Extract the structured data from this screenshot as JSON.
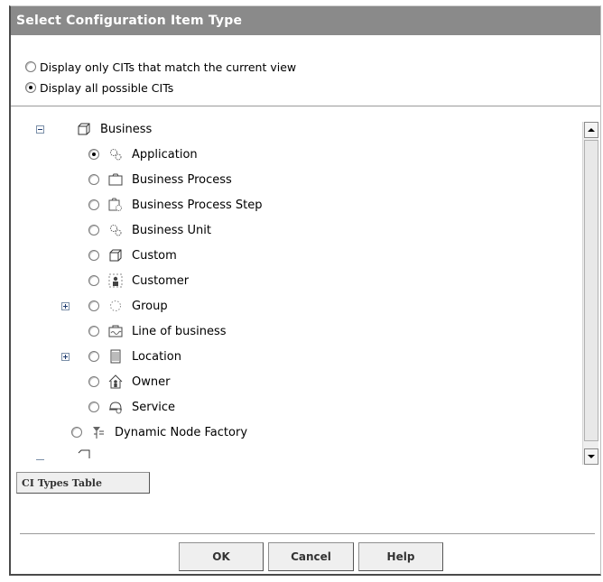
{
  "dialog": {
    "title": "Select Configuration Item Type",
    "options": [
      {
        "label": "Display only CITs that match the current view",
        "checked": false
      },
      {
        "label": "Display all possible CITs",
        "checked": true
      }
    ]
  },
  "tree": {
    "root": {
      "label": "Business",
      "icon": "cube-icon",
      "expanded": true
    },
    "children": [
      {
        "label": "Application",
        "icon": "gears-icon",
        "checked": true,
        "expandable": false
      },
      {
        "label": "Business Process",
        "icon": "folder-icon",
        "checked": false,
        "expandable": false
      },
      {
        "label": "Business Process Step",
        "icon": "process-step-icon",
        "checked": false,
        "expandable": false
      },
      {
        "label": "Business Unit",
        "icon": "gears-icon",
        "checked": false,
        "expandable": false
      },
      {
        "label": "Custom",
        "icon": "cube-icon",
        "checked": false,
        "expandable": false
      },
      {
        "label": "Customer",
        "icon": "customer-icon",
        "checked": false,
        "expandable": false
      },
      {
        "label": "Group",
        "icon": "group-icon",
        "checked": false,
        "expandable": true
      },
      {
        "label": "Line of business",
        "icon": "briefcase-icon",
        "checked": false,
        "expandable": false
      },
      {
        "label": "Location",
        "icon": "building-icon",
        "checked": false,
        "expandable": true
      },
      {
        "label": "Owner",
        "icon": "house-person-icon",
        "checked": false,
        "expandable": false
      },
      {
        "label": "Service",
        "icon": "service-icon",
        "checked": false,
        "expandable": false
      }
    ],
    "sibling": {
      "label": "Dynamic Node Factory",
      "icon": "factory-icon",
      "checked": false
    }
  },
  "buttons": {
    "ci_types_table": "CI Types Table",
    "ok": "OK",
    "cancel": "Cancel",
    "help": "Help"
  }
}
